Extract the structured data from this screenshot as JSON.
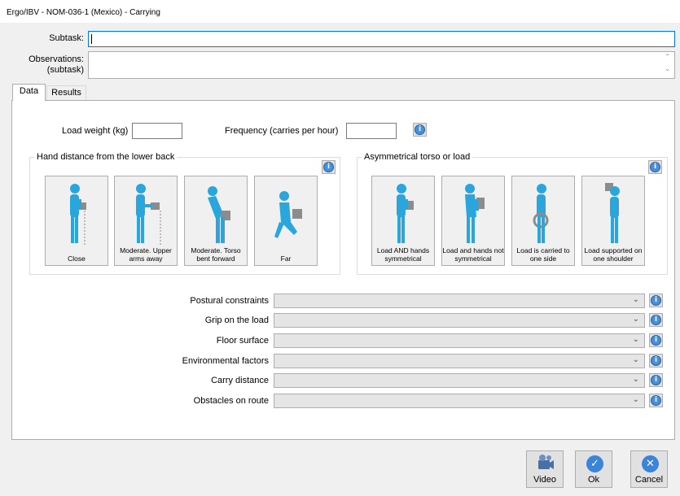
{
  "window": {
    "title": "Ergo/IBV - NOM-036-1 (Mexico) - Carrying"
  },
  "form": {
    "subtask_label": "Subtask:",
    "subtask_value": "",
    "observations_label_line1": "Observations:",
    "observations_label_line2": "(subtask)",
    "observations_value": ""
  },
  "tabs": [
    {
      "label": "Data"
    },
    {
      "label": "Results"
    }
  ],
  "data": {
    "load_weight_label": "Load weight (kg)",
    "load_weight_value": "",
    "frequency_label": "Frequency (carries per hour)",
    "frequency_value": "",
    "hand_distance": {
      "title": "Hand distance from the lower back",
      "options": [
        {
          "label": "Close",
          "icon": "standing-close-load-icon"
        },
        {
          "label": "Moderate. Upper arms away",
          "icon": "standing-arms-away-icon"
        },
        {
          "label": "Moderate. Torso bent forward",
          "icon": "torso-bent-forward-icon"
        },
        {
          "label": "Far",
          "icon": "squatting-far-load-icon"
        }
      ]
    },
    "asymmetry": {
      "title": "Asymmetrical torso or load",
      "options": [
        {
          "label": "Load AND hands symmetrical",
          "icon": "symmetrical-load-icon"
        },
        {
          "label": "Load and hands not symmetrical",
          "icon": "asymmetrical-load-icon"
        },
        {
          "label": "Load is carried to one side",
          "icon": "side-carry-icon"
        },
        {
          "label": "Load supported on one shoulder",
          "icon": "shoulder-carry-icon"
        }
      ]
    },
    "dropdowns": [
      {
        "label": "Postural constraints",
        "value": ""
      },
      {
        "label": "Grip on the load",
        "value": ""
      },
      {
        "label": "Floor surface",
        "value": ""
      },
      {
        "label": "Environmental factors",
        "value": ""
      },
      {
        "label": "Carry distance",
        "value": ""
      },
      {
        "label": "Obstacles on route",
        "value": ""
      }
    ]
  },
  "buttons": {
    "video_label": "Video",
    "ok_label": "Ok",
    "cancel_label": "Cancel"
  },
  "colors": {
    "figure": "#2aa6dd",
    "ok_icon": "#3b84d9",
    "cancel_icon": "#3b84d9",
    "info_icon": "#4a90d9",
    "focus_border": "#0078d7"
  }
}
